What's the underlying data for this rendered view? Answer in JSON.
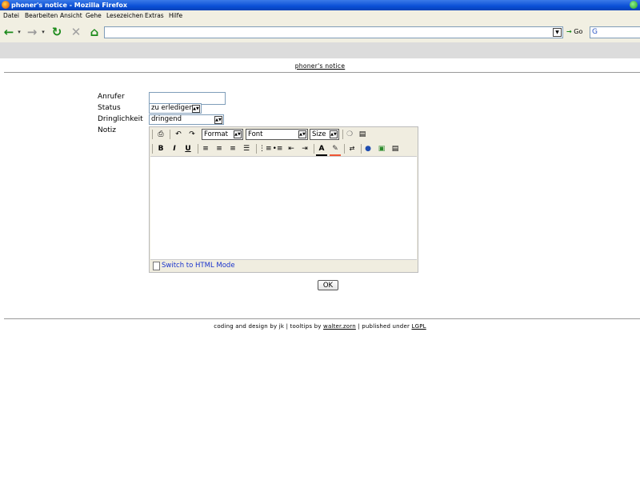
{
  "window": {
    "title": "phoner's notice - Mozilla Firefox"
  },
  "menu": [
    "Datei",
    "Bearbeiten",
    "Ansicht",
    "Gehe",
    "Lesezeichen",
    "Extras",
    "Hilfe"
  ],
  "navbar": {
    "go_label": "Go"
  },
  "page": {
    "title_link": "phoner's notice",
    "form": {
      "caller_label": "Anrufer",
      "caller_value": "",
      "status_label": "Status",
      "status_value": "zu erledigen",
      "urgency_label": "Dringlichkeit",
      "urgency_value": "dringend",
      "note_label": "Notiz",
      "editor": {
        "format_select": "Format",
        "font_select": "Font",
        "size_select": "Size",
        "html_mode_link": "Switch to HTML Mode"
      },
      "ok_button": "OK"
    },
    "footer": {
      "prefix": "coding and design by jk | tooltips by ",
      "tooltips_link": "walter.zorn",
      "middle": " | published under ",
      "license_link": "LGPL"
    }
  }
}
